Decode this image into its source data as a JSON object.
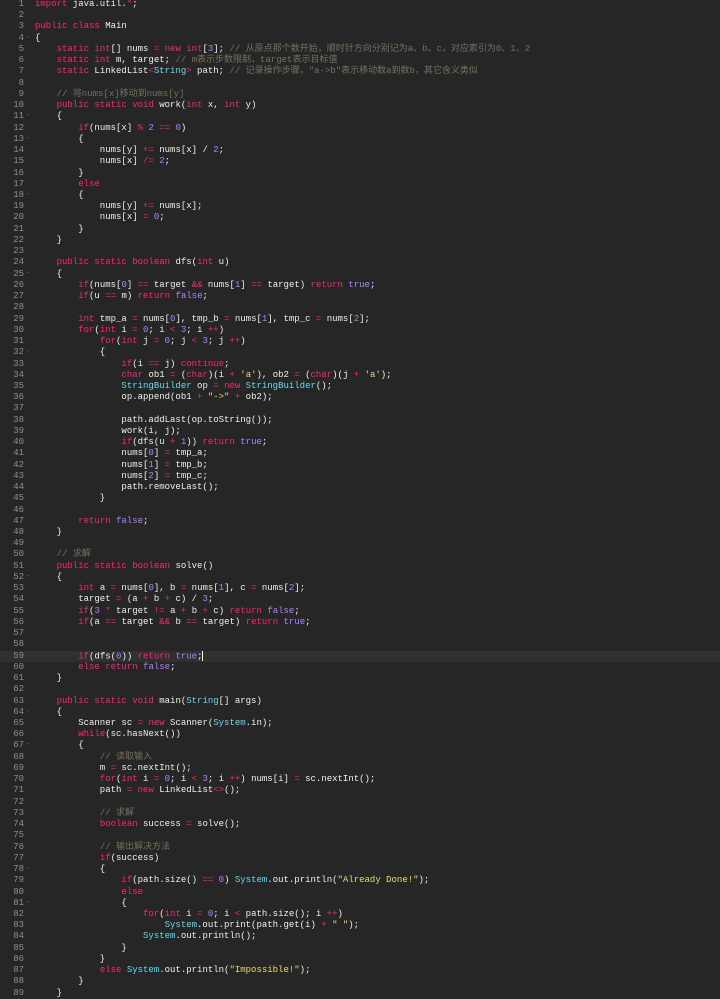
{
  "editor": {
    "current_line": 59,
    "fold_lines": [
      4,
      11,
      13,
      18,
      25,
      32,
      52,
      64,
      67,
      78,
      81
    ],
    "fold_marker": "-",
    "colors": {
      "background": "#262626",
      "keyword": "#f92672",
      "type": "#66d9ef",
      "number": "#ae81ff",
      "string": "#e6db74",
      "comment": "#75715e"
    },
    "lines": [
      "import java.util.*;",
      "",
      "public class Main",
      "{",
      "    static int[] nums = new int[3]; // 从原点那个数开始，顺时针方向分别记为a、b、c，对应索引为0、1、2",
      "    static int m, target; // m表示步数限制，target表示目标值",
      "    static LinkedList<String> path; // 记录操作步骤，\"a->b\"表示移动数a到数b，其它含义类似",
      "",
      "    // 将nums[x]移动到nums[y]",
      "    public static void work(int x, int y)",
      "    {",
      "        if(nums[x] % 2 == 0)",
      "        {",
      "            nums[y] += nums[x] / 2;",
      "            nums[x] /= 2;",
      "        }",
      "        else",
      "        {",
      "            nums[y] += nums[x];",
      "            nums[x] = 0;",
      "        }",
      "    }",
      "",
      "    public static boolean dfs(int u)",
      "    {",
      "        if(nums[0] == target && nums[1] == target) return true;",
      "        if(u == m) return false;",
      "",
      "        int tmp_a = nums[0], tmp_b = nums[1], tmp_c = nums[2];",
      "        for(int i = 0; i < 3; i ++)",
      "            for(int j = 0; j < 3; j ++)",
      "            {",
      "                if(i == j) continue;",
      "                char ob1 = (char)(i + 'a'), ob2 = (char)(j + 'a');",
      "                StringBuilder op = new StringBuilder();",
      "                op.append(ob1 + \"->\" + ob2);",
      "",
      "                path.addLast(op.toString());",
      "                work(i, j);",
      "                if(dfs(u + 1)) return true;",
      "                nums[0] = tmp_a;",
      "                nums[1] = tmp_b;",
      "                nums[2] = tmp_c;",
      "                path.removeLast();",
      "            }",
      "",
      "        return false;",
      "    }",
      "",
      "    // 求解",
      "    public static boolean solve()",
      "    {",
      "        int a = nums[0], b = nums[1], c = nums[2];",
      "        target = (a + b + c) / 3;",
      "        if(3 * target != a + b + c) return false;",
      "        if(a == target && b == target) return true;",
      "",
      "",
      "        if(dfs(0)) return true;",
      "        else return false;",
      "    }",
      "",
      "    public static void main(String[] args)",
      "    {",
      "        Scanner sc = new Scanner(System.in);",
      "        while(sc.hasNext())",
      "        {",
      "            // 读取输入",
      "            m = sc.nextInt();",
      "            for(int i = 0; i < 3; i ++) nums[i] = sc.nextInt();",
      "            path = new LinkedList<>();",
      "",
      "            // 求解",
      "            boolean success = solve();",
      "",
      "            // 输出解决方法",
      "            if(success)",
      "            {",
      "                if(path.size() == 0) System.out.println(\"Already Done!\");",
      "                else",
      "                {",
      "                    for(int i = 0; i < path.size(); i ++)",
      "                        System.out.print(path.get(i) + \" \");",
      "                    System.out.println();",
      "                }",
      "            }",
      "            else System.out.println(\"Impossible!\");",
      "        }",
      "    }"
    ]
  }
}
